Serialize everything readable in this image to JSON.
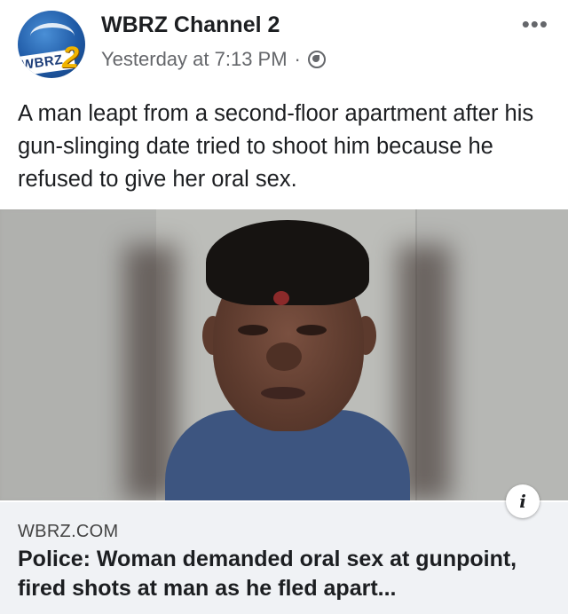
{
  "post": {
    "page_name": "WBRZ Channel 2",
    "timestamp": "Yesterday at 7:13 PM",
    "separator": "·",
    "audience_icon": "globe-icon",
    "more_icon": "ellipsis-icon",
    "more_label": "•••",
    "avatar": {
      "text": "WBRZ",
      "number": "2"
    },
    "text": "A man leapt from a second-floor apartment after his gun-slinging date tried to shoot him because he refused to give her oral sex."
  },
  "link_preview": {
    "info_label": "i",
    "domain": "WBRZ.COM",
    "headline": "Police: Woman demanded oral sex at gunpoint, fired shots at man as he fled apart..."
  },
  "colors": {
    "page_name": "#1c1e21",
    "meta": "#65676b",
    "link_box_bg": "#f0f2f5"
  }
}
